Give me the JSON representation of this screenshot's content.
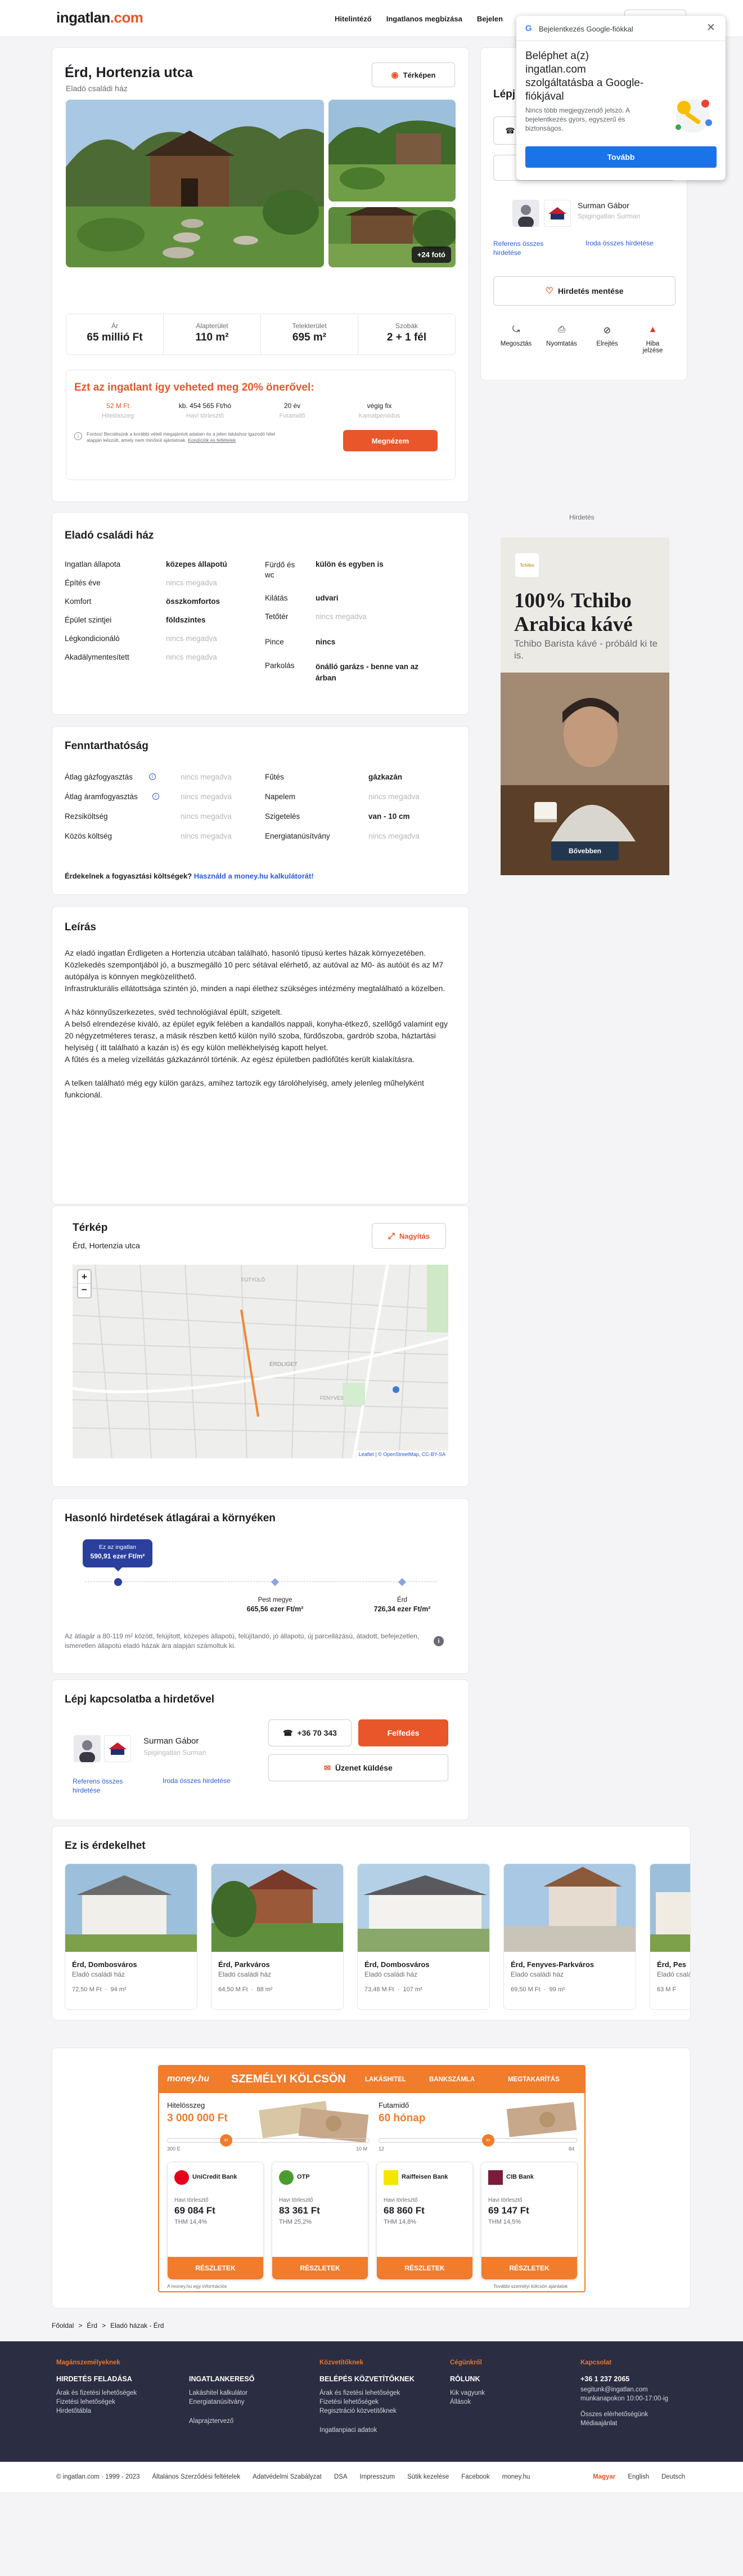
{
  "header": {
    "logo_text": "ingatlan",
    "logo_domain": ".com",
    "nav": [
      "Hitelintéző",
      "Ingatlanos megbízása",
      "Bejelen"
    ]
  },
  "google_popup": {
    "title": "Bejelentkezés Google-fiókkal",
    "heading": "Beléphet a(z) ingatlan.com szolgáltatásba a Google-fiókjával",
    "body": "Nincs több megjegyzendő jelszó. A bejelentkezés gyors, egyszerű és biztonságos.",
    "button": "Tovább"
  },
  "listing": {
    "title": "Érd, Hortenzia utca",
    "subtitle": "Eladó családi ház",
    "map_button": "Térképen",
    "photo_count": "+24 fotó",
    "stats": [
      {
        "label": "Ár",
        "value": "65 millió Ft"
      },
      {
        "label": "Alapterület",
        "value": "110 m²"
      },
      {
        "label": "Telekterület",
        "value": "695 m²"
      },
      {
        "label": "Szobák",
        "value": "2 + 1 fél"
      }
    ],
    "loan": {
      "headline": "Ezt az ingatlant így veheted meg 20% önerővel:",
      "cols": [
        {
          "value": "52 M Ft",
          "label": "Hitelösszeg"
        },
        {
          "value": "kb. 454 565 Ft/hó",
          "label": "Havi törlesztő"
        },
        {
          "value": "20 év",
          "label": "Futamidő"
        },
        {
          "value": "végig fix",
          "label": "Kamatperiódus"
        }
      ],
      "note": "Fontos! Becslésünk a korábbi vételi megajánlott adatain és a jelen lakáshoz igazodó hitel alapján készült, amely nem minősül ajánlatnak.",
      "note_link": "Kondíciók és feltételek",
      "button": "Megnézem"
    }
  },
  "contact_sidebar": {
    "title": "Lépj",
    "phone_placeholder": "",
    "agent_name": "Surman Gábor",
    "agent_company": "Spigingatlan Surman",
    "ref_link": "Referens összes hirdetése",
    "office_link": "Iroda összes hirdetése",
    "save_button": "Hirdetés mentése",
    "actions": [
      "Megosztás",
      "Nyomtatás",
      "Elrejtés",
      "Hiba jelzése"
    ]
  },
  "ad": {
    "label": "Hirdetés",
    "brand": "Tchibo",
    "headline": "100% Tchibo Arabica kávé",
    "sub": "Tchibo Barista kávé - próbáld ki te is.",
    "button": "Bővebben"
  },
  "details": {
    "title": "Eladó családi ház",
    "left": [
      {
        "label": "Ingatlan állapota",
        "value": "közepes állapotú"
      },
      {
        "label": "Építés éve",
        "value": "nincs megadva"
      },
      {
        "label": "Komfort",
        "value": "összkomfortos"
      },
      {
        "label": "Épület szintjei",
        "value": "földszintes"
      },
      {
        "label": "Légkondicionáló",
        "value": "nincs megadva"
      },
      {
        "label": "Akadálymentesített",
        "value": "nincs megadva"
      }
    ],
    "right": [
      {
        "label": "Fürdő és wc",
        "value": "külön és egyben is"
      },
      {
        "label": "Kilátás",
        "value": "udvari"
      },
      {
        "label": "Tetőtér",
        "value": "nincs megadva"
      },
      {
        "label": "Pince",
        "value": "nincs"
      },
      {
        "label": "Parkolás",
        "value": "önálló garázs - benne van az árban"
      }
    ]
  },
  "sustainability": {
    "title": "Fenntarthatóság",
    "left": [
      {
        "label": "Átlag gázfogyasztás",
        "value": "nincs megadva"
      },
      {
        "label": "Átlag áramfogyasztás",
        "value": "nincs megadva"
      },
      {
        "label": "Rezsiköltség",
        "value": "nincs megadva"
      },
      {
        "label": "Közös költség",
        "value": "nincs megadva"
      }
    ],
    "right": [
      {
        "label": "Fűtés",
        "value": "gázkazán"
      },
      {
        "label": "Napelem",
        "value": "nincs megadva"
      },
      {
        "label": "Szigetelés",
        "value": "van - 10 cm"
      },
      {
        "label": "Energiatanúsítvány",
        "value": "nincs megadva"
      }
    ],
    "calc_question": "Érdekelnek a fogyasztási költségek?",
    "calc_link": "Használd a money.hu kalkulátorát!"
  },
  "description": {
    "title": "Leírás",
    "paragraphs": [
      "Az eladó ingatlan Érdligeten a Hortenzia utcában található, hasonló típusú kertes házak környezetében.",
      "Közlekedés szempontjából jó, a buszmegálló 10 perc sétával elérhető, az autóval az M0- ás autóút és az M7 autópálya is könnyen megközelíthető.",
      "Infrastrukturális ellátottsága szintén jó, minden a napi élethez szükséges intézmény megtalálható a közelben.",
      "A ház könnyűszerkezetes, svéd technológiával épült, szigetelt.",
      "A belső elrendezése kiváló, az épület egyik felében a kandallós nappali, konyha-étkező, szellőgő valamint egy 20 négyzetméteres terasz, a másik részben kettő külön nyíló szoba, fürdőszoba, gardrób szoba, háztartási helyiség ( itt található a kazán is) és egy külön mellékhelyiség kapott helyet.",
      "A fűtés és a meleg vízellátás gázkazánról történik. Az egész épületben padlófűtés került kialakításra.",
      "A telken található még egy külön garázs, amihez tartozik egy tárolóhelyiség, amely jelenleg műhelyként funkcionál."
    ]
  },
  "map": {
    "title": "Térkép",
    "subtitle": "Érd, Hortenzia utca",
    "zoom_button": "Nagyítás",
    "attribution": "Leaflet | © OpenStreetMap, CC-BY-SA",
    "labels": [
      "ÉRDLIGET",
      "FÜTYÜLŐ",
      "FENYVES"
    ]
  },
  "similar_prices": {
    "title": "Hasonló hirdetések átlagárai a környéken",
    "this_label": "Ez az ingatlan",
    "this_value": "590,91 ezer Ft/m²",
    "points": [
      {
        "label": "Pest megye",
        "value": "665,56 ezer Ft/m²"
      },
      {
        "label": "Érd",
        "value": "726,34 ezer Ft/m²"
      }
    ],
    "note": "Az átlagár a 80-119 m² között, felújított, közepes állapotú, felújítandó, jó állapotú, új parcellázású, átadott, befejezetlen, ismeretlen állapotú eladó házak ára alapján számoltuk ki."
  },
  "contact_bottom": {
    "title": "Lépj kapcsolatba a hirdetővel",
    "agent_name": "Surman Gábor",
    "agent_company": "Spigingatlan Surman",
    "ref_link": "Referens összes hirdetése",
    "office_link": "Iroda összes hirdetése",
    "phone": "+36 70 343",
    "reveal": "Felfedés",
    "message": "Üzenet küldése"
  },
  "recommendations": {
    "title": "Ez is érdekelhet",
    "items": [
      {
        "title": "Érd, Dombosváros",
        "type": "Eladó családi ház",
        "price": "72,50 M Ft",
        "area": "94 m²"
      },
      {
        "title": "Érd, Parkváros",
        "type": "Eladó családi ház",
        "price": "64,50 M Ft",
        "area": "88 m²"
      },
      {
        "title": "Érd, Dombosváros",
        "type": "Eladó családi ház",
        "price": "73,48 M Ft",
        "area": "107 m²"
      },
      {
        "title": "Érd, Fenyves-Parkváros",
        "type": "Eladó családi ház",
        "price": "69,50 M Ft",
        "area": "99 m²"
      },
      {
        "title": "Érd, Pes",
        "type": "Eladó családi ház",
        "price": "63 M F",
        "area": ""
      }
    ]
  },
  "money_widget": {
    "brand": "money.hu",
    "title": "SZEMÉLYI KÖLCSÖN",
    "tabs": [
      "LAKÁSHITEL",
      "BANKSZÁMLA",
      "MEGTAKARÍTÁS"
    ],
    "amount_label": "Hitelösszeg",
    "amount_value": "3 000 000 Ft",
    "term_label": "Futamidő",
    "term_value": "60 hónap",
    "amount_min": "300 E",
    "amount_max": "10 M",
    "term_min": "12",
    "term_max": "84",
    "banks": [
      {
        "name": "UniCredit Bank",
        "label": "Havi törlesztő",
        "value": "69 084 Ft",
        "thm": "THM 14,4%",
        "color": "#e2001a"
      },
      {
        "name": "OTP",
        "label": "Havi törlesztő",
        "value": "83 361 Ft",
        "thm": "THM 25,2%",
        "color": "#4c9b2f"
      },
      {
        "name": "Raiffeisen Bank",
        "label": "Havi törlesztő",
        "value": "68 860 Ft",
        "thm": "THM 14,8%",
        "color": "#f6e500"
      },
      {
        "name": "CIB Bank",
        "label": "Havi törlesztő",
        "value": "69 147 Ft",
        "thm": "THM 14,5%",
        "color": "#7a1d3a"
      }
    ],
    "more_button": "RÉSZLETEK",
    "footnote_left": "A money.hu egy információs",
    "footnote_right": "További személyi kölcsön ajánlatok"
  },
  "breadcrumb": [
    "Főoldal",
    "Érd",
    "Eladó házak - Érd"
  ],
  "footer": {
    "columns": [
      {
        "heading": "Magánszemélyeknek",
        "title": "HIRDETÉS FELADÁSA",
        "items": [
          "Árak és fizetési lehetőségek",
          "Fizetési lehetőségek",
          "Hirdetőtábla"
        ]
      },
      {
        "heading": "",
        "title": "INGATLANKERESŐ",
        "items": [
          "Lakáshitel kalkulátor",
          "Energiatanúsítvány",
          "",
          "Alaprajztervező"
        ]
      },
      {
        "heading": "Közvetítőknek",
        "title": "BELÉPÉS KÖZVETÍTŐKNEK",
        "items": [
          "Árak és fizetési lehetőségek",
          "Fizetési lehetőségek",
          "Regisztráció közvetítőknek",
          "",
          "Ingatlanpiaci adatok"
        ]
      },
      {
        "heading": "Cégünkről",
        "title": "RÓLUNK",
        "items": [
          "Kik vagyunk",
          "Állások"
        ]
      },
      {
        "heading": "Kapcsolat",
        "title": "+36 1 237 2065",
        "items": [
          "segitunk@ingatlan.com",
          "munkanapokon 10:00-17:00-ig",
          "",
          "Összes elérhetőségünk",
          "Médiaajánlat"
        ]
      }
    ],
    "bottom_links": [
      "© ingatlan.com · 1999 - 2023",
      "Általános Szerződési feltételek",
      "Adatvédelmi Szabályzat",
      "DSA",
      "Impresszum",
      "Sütik kezelése",
      "Facebook",
      "money.hu"
    ],
    "languages": [
      "Magyar",
      "English",
      "Deutsch"
    ]
  }
}
